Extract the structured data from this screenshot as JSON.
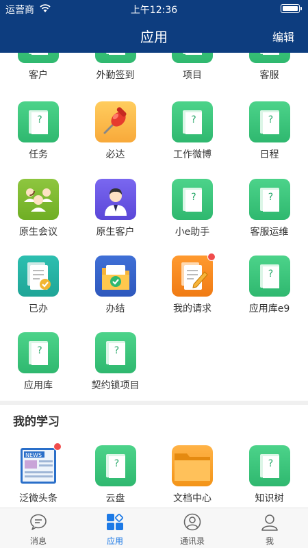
{
  "status_bar": {
    "carrier": "运营商",
    "time": "上午12:36"
  },
  "header": {
    "title": "应用",
    "edit_label": "编辑"
  },
  "apps": [
    {
      "label": "客户",
      "icon": "green-doc-icon",
      "badge": false
    },
    {
      "label": "外勤签到",
      "icon": "green-doc-icon",
      "badge": false
    },
    {
      "label": "项目",
      "icon": "green-doc-icon",
      "badge": false
    },
    {
      "label": "客服",
      "icon": "green-doc-icon",
      "badge": false
    },
    {
      "label": "任务",
      "icon": "green-doc-icon",
      "badge": false
    },
    {
      "label": "必达",
      "icon": "pushpin-icon",
      "badge": false
    },
    {
      "label": "工作微博",
      "icon": "green-doc-icon",
      "badge": false
    },
    {
      "label": "日程",
      "icon": "green-doc-icon",
      "badge": false
    },
    {
      "label": "原生会议",
      "icon": "meeting-people-icon",
      "badge": false
    },
    {
      "label": "原生客户",
      "icon": "customer-avatar-icon",
      "badge": false
    },
    {
      "label": "小e助手",
      "icon": "green-doc-icon",
      "badge": false
    },
    {
      "label": "客服运维",
      "icon": "green-doc-icon",
      "badge": false
    },
    {
      "label": "已办",
      "icon": "done-docs-icon",
      "badge": false
    },
    {
      "label": "办结",
      "icon": "folder-check-icon",
      "badge": false
    },
    {
      "label": "我的请求",
      "icon": "request-edit-icon",
      "badge": true
    },
    {
      "label": "应用库e9",
      "icon": "green-doc-icon",
      "badge": false
    },
    {
      "label": "应用库",
      "icon": "green-doc-icon",
      "badge": false
    },
    {
      "label": "契约锁项目",
      "icon": "green-doc-icon",
      "badge": false
    }
  ],
  "learning": {
    "title": "我的学习",
    "apps": [
      {
        "label": "泛微头条",
        "icon": "news-icon",
        "badge": true
      },
      {
        "label": "云盘",
        "icon": "green-doc-icon",
        "badge": false
      },
      {
        "label": "文档中心",
        "icon": "orange-folder-icon",
        "badge": false
      },
      {
        "label": "知识树",
        "icon": "green-doc-icon",
        "badge": false
      }
    ]
  },
  "tabs": [
    {
      "label": "消息",
      "icon": "message-icon",
      "active": false
    },
    {
      "label": "应用",
      "icon": "apps-grid-icon",
      "active": true
    },
    {
      "label": "通讯录",
      "icon": "contacts-icon",
      "active": false
    },
    {
      "label": "我",
      "icon": "profile-icon",
      "active": false
    }
  ],
  "colors": {
    "header": "#0d3d7f",
    "accent": "#1d7ae6",
    "app_green": "#3cc47c",
    "badge": "#f04c4c"
  }
}
